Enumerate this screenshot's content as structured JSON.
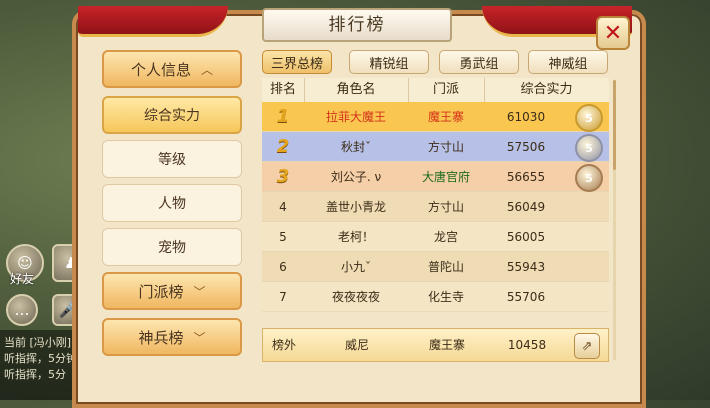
{
  "window": {
    "title": "排行榜"
  },
  "menu": {
    "sections": [
      {
        "label": "个人信息",
        "expanded": true
      },
      {
        "label": "门派榜",
        "expanded": false
      },
      {
        "label": "神兵榜",
        "expanded": false
      }
    ],
    "sub_items": [
      {
        "label": "综合实力",
        "active": true
      },
      {
        "label": "等级",
        "active": false
      },
      {
        "label": "人物",
        "active": false
      },
      {
        "label": "宠物",
        "active": false
      }
    ]
  },
  "tabs": [
    {
      "label": "三界总榜",
      "active": true
    },
    {
      "label": "精锐组",
      "active": false
    },
    {
      "label": "勇武组",
      "active": false
    },
    {
      "label": "神威组",
      "active": false
    }
  ],
  "table": {
    "headers": [
      "排名",
      "角色名",
      "门派",
      "综合实力"
    ],
    "rows": [
      {
        "rank": "1",
        "name": "拉菲大魔王",
        "sect": "魔王寨",
        "power": "61030",
        "medal": "gold"
      },
      {
        "rank": "2",
        "name": "秋封ˇ",
        "sect": "方寸山",
        "power": "57506",
        "medal": "silver"
      },
      {
        "rank": "3",
        "name": "刘公子. ν",
        "sect": "大唐官府",
        "power": "56655",
        "medal": "bronze"
      },
      {
        "rank": "4",
        "name": "盖世小青龙",
        "sect": "方寸山",
        "power": "56049"
      },
      {
        "rank": "5",
        "name": "老柯！",
        "sect": "龙宫",
        "power": "56005"
      },
      {
        "rank": "6",
        "name": "小九ˇ",
        "sect": "普陀山",
        "power": "55943"
      },
      {
        "rank": "7",
        "name": "夜夜夜夜",
        "sect": "化生寺",
        "power": "55706"
      }
    ],
    "medal_number": "5"
  },
  "footer": {
    "rank": "榜外",
    "name": "威尼",
    "sect": "魔王寨",
    "power": "10458"
  },
  "background": {
    "friends_label": "好友",
    "world_label": "世",
    "icon_badge": "5",
    "chat_lines": [
      "当前 [冯小刚]",
      "听指挥，5分钟",
      "听指挥，5分"
    ]
  },
  "colors": {
    "row1_bg": "#f9c650",
    "row2_bg": "#b7c0e6",
    "row3_bg": "#f5cfa8",
    "row_even": "#f4e6c4",
    "row_odd": "#efdcb5",
    "name_red": "#d4331b",
    "medal_gold": "#c99a2e",
    "medal_silver": "#8f92a6",
    "medal_bronze": "#a77c52"
  }
}
